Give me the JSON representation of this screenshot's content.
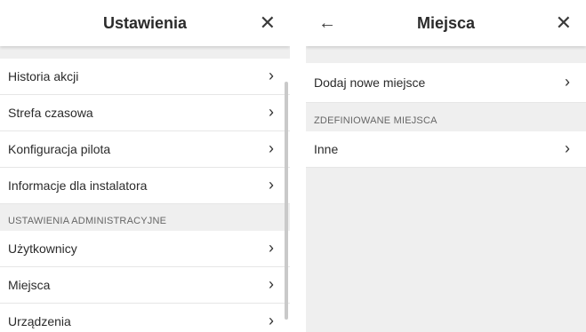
{
  "settings": {
    "title": "Ustawienia",
    "close_icon": "close-icon",
    "items": [
      {
        "label": "Historia akcji"
      },
      {
        "label": "Strefa czasowa"
      },
      {
        "label": "Konfiguracja pilota"
      },
      {
        "label": "Informacje dla instalatora"
      }
    ],
    "admin_section_label": "USTAWIENIA ADMINISTRACYJNE",
    "admin_items": [
      {
        "label": "Użytkownicy"
      },
      {
        "label": "Miejsca"
      },
      {
        "label": "Urządzenia"
      }
    ]
  },
  "places": {
    "title": "Miejsca",
    "back_icon": "arrow-left-icon",
    "close_icon": "close-icon",
    "add_label": "Dodaj nowe miejsce",
    "defined_section_label": "ZDEFINIOWANE MIEJSCA",
    "defined_items": [
      {
        "label": "Inne"
      }
    ]
  },
  "chevron": "›"
}
